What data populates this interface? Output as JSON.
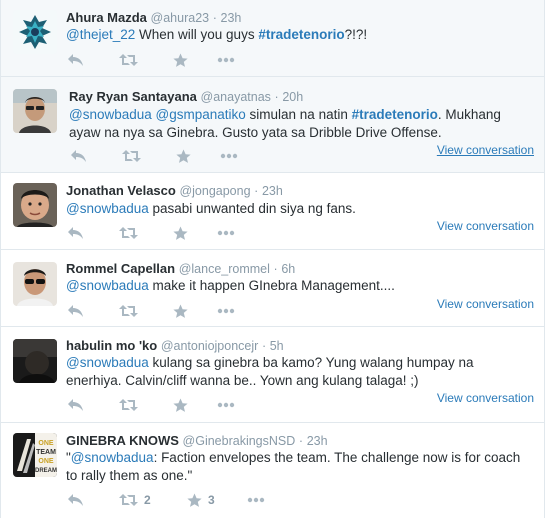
{
  "tweets": [
    {
      "name": "Ahura Mazda",
      "handle": "@ahura23",
      "sep": "·",
      "time": "23h",
      "text_parts": [
        {
          "t": "@thejet_22",
          "k": "mention"
        },
        {
          "t": " When will you guys ",
          "k": "plain"
        },
        {
          "t": "#tradetenorio",
          "k": "hashtag"
        },
        {
          "t": "?!?!",
          "k": "plain"
        }
      ],
      "view_conversation": "",
      "retweet_count": "",
      "favorite_count": "",
      "avatar_icon": "hornets-logo-icon"
    },
    {
      "name": "Ray Ryan Santayana",
      "handle": "@anayatnas",
      "sep": "·",
      "time": "20h",
      "text_parts": [
        {
          "t": "@snowbadua",
          "k": "mention"
        },
        {
          "t": " ",
          "k": "plain"
        },
        {
          "t": "@gsmpanatiko",
          "k": "mention"
        },
        {
          "t": " simulan na natin ",
          "k": "plain"
        },
        {
          "t": "#tradetenorio",
          "k": "hashtag"
        },
        {
          "t": ". Mukhang ayaw na nya sa Ginebra. Gusto yata sa Dribble Drive Offense.",
          "k": "plain"
        }
      ],
      "view_conversation": "View conversation",
      "retweet_count": "",
      "favorite_count": "",
      "avatar_icon": "user-photo-icon"
    },
    {
      "name": "Jonathan Velasco",
      "handle": "@jongapong",
      "sep": "·",
      "time": "23h",
      "text_parts": [
        {
          "t": "@snowbadua",
          "k": "mention"
        },
        {
          "t": " pasabi unwanted din siya ng fans.",
          "k": "plain"
        }
      ],
      "view_conversation": "View conversation",
      "retweet_count": "",
      "favorite_count": "",
      "avatar_icon": "user-photo-icon"
    },
    {
      "name": "Rommel Capellan",
      "handle": "@lance_rommel",
      "sep": "·",
      "time": "6h",
      "text_parts": [
        {
          "t": "@snowbadua",
          "k": "mention"
        },
        {
          "t": " make it happen GInebra Management....",
          "k": "plain"
        }
      ],
      "view_conversation": "View conversation",
      "retweet_count": "",
      "favorite_count": "",
      "avatar_icon": "user-photo-icon"
    },
    {
      "name": "habulin mo 'ko",
      "handle": "@antoniojponcejr",
      "sep": "·",
      "time": "5h",
      "text_parts": [
        {
          "t": "@snowbadua",
          "k": "mention"
        },
        {
          "t": " kulang sa ginebra ba kamo? Yung walang humpay na enerhiya. Calvin/cliff wanna be.. Yown ang kulang talaga! ;)",
          "k": "plain"
        }
      ],
      "view_conversation": "View conversation",
      "retweet_count": "",
      "favorite_count": "",
      "avatar_icon": "user-photo-icon"
    },
    {
      "name": "GINEBRA KNOWS",
      "handle": "@GinebrakingsNSD",
      "sep": "·",
      "time": "23h",
      "text_parts": [
        {
          "t": "\"",
          "k": "plain"
        },
        {
          "t": "@snowbadua",
          "k": "mention"
        },
        {
          "t": ": Faction envelopes the team.  The challenge now is for coach to rally them as one.\"",
          "k": "plain"
        }
      ],
      "view_conversation": "",
      "retweet_count": "2",
      "favorite_count": "3",
      "avatar_icon": "ginebra-logo-icon",
      "avatar_text": [
        "ONE",
        "TEAM",
        "ONE",
        "DREAM"
      ]
    }
  ],
  "colors": {
    "link": "#2b7bb9",
    "muted": "#8899a6",
    "icon": "#aab8c2",
    "highlight_bg": "#f5f8fa"
  }
}
